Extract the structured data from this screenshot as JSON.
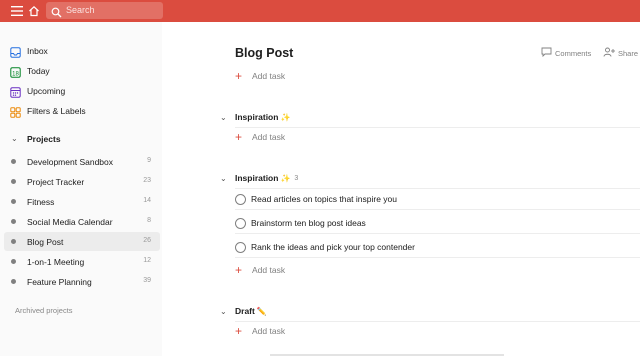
{
  "topbar": {
    "color": "#db4c3f",
    "menu_icon": "menu-icon",
    "home_icon": "home-icon",
    "search": {
      "icon": "search-icon",
      "placeholder": "Search"
    }
  },
  "sidebar": {
    "nav": [
      {
        "label": "Inbox",
        "icon": "inbox-icon",
        "color": "#246fe0"
      },
      {
        "label": "Today",
        "icon": "calendar-today-icon",
        "color": "#058527"
      },
      {
        "label": "Upcoming",
        "icon": "calendar-upcoming-icon",
        "color": "#692fc2"
      },
      {
        "label": "Filters & Labels",
        "icon": "filters-icon",
        "color": "#eb8909"
      }
    ],
    "projects_header": "Projects",
    "projects": [
      {
        "label": "Development Sandbox",
        "count": "9"
      },
      {
        "label": "Project Tracker",
        "count": "23"
      },
      {
        "label": "Fitness",
        "count": "14"
      },
      {
        "label": "Social Media Calendar",
        "count": "8"
      },
      {
        "label": "Blog Post",
        "count": "26",
        "active": true
      },
      {
        "label": "1-on-1 Meeting",
        "count": "12"
      },
      {
        "label": "Feature Planning",
        "count": "39"
      }
    ],
    "archived_label": "Archived projects"
  },
  "main": {
    "title": "Blog Post",
    "comments_label": "Comments",
    "share_label": "Share",
    "add_task_label": "Add task",
    "sections": [
      {
        "name": "Inspiration",
        "emoji": "✨",
        "count": ""
      },
      {
        "name": "Inspiration",
        "emoji": "✨",
        "count": "3",
        "tasks": [
          "Read articles on topics that inspire you",
          "Brainstorm ten blog post ideas",
          "Rank the ideas and pick your top contender"
        ]
      },
      {
        "name": "Draft",
        "emoji": "✏️",
        "count": ""
      }
    ]
  }
}
